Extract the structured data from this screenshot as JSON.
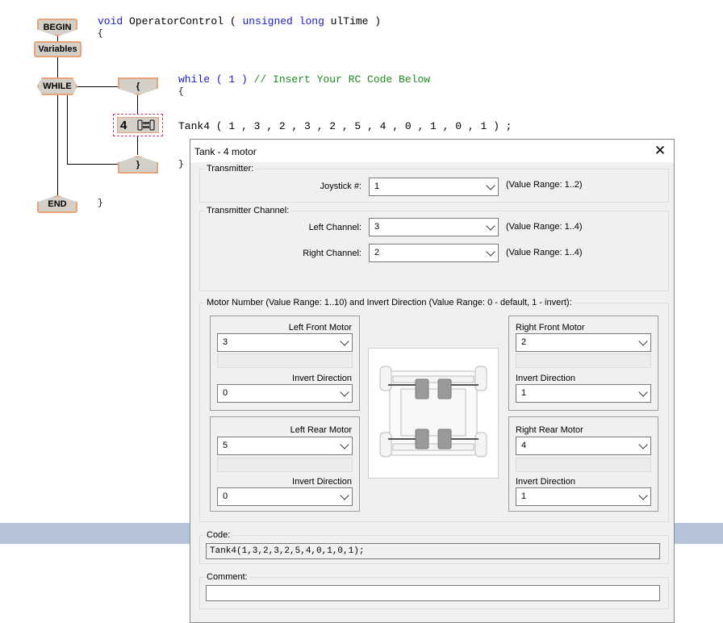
{
  "flowchart": {
    "begin": "BEGIN",
    "variables": "Variables",
    "while": "WHILE",
    "open_brace": "{",
    "close_brace": "}",
    "block_num": "4",
    "end": "END"
  },
  "code_view": {
    "line1_kw": "void",
    "line1_name": " OperatorControl ( ",
    "line1_kw2": "unsigned long",
    "line1_rest": " ulTime )",
    "brace_open": "{",
    "while_kw": "while",
    "while_rest": " ( 1 ) ",
    "while_comment": "// Insert Your RC Code Below",
    "brace_open2": "{",
    "tank_call": "Tank4 ( 1 , 3 , 2 , 3 , 2 , 5 , 4 , 0 , 1 , 0 , 1 ) ;",
    "brace_close_inner": "}",
    "brace_close": "}"
  },
  "dialog": {
    "title": "Tank - 4 motor",
    "close_symbol": "✕",
    "transmitter": {
      "legend": "Transmitter:",
      "joystick_label": "Joystick #:",
      "joystick_value": "1",
      "joystick_range": "(Value Range: 1..2)"
    },
    "channel": {
      "legend": "Transmitter Channel:",
      "left_label": "Left Channel:",
      "left_value": "3",
      "left_range": "(Value Range: 1..4)",
      "right_label": "Right Channel:",
      "right_value": "2",
      "right_range": "(Value Range: 1..4)"
    },
    "motor": {
      "legend": "Motor Number (Value Range: 1..10)  and  Invert Direction (Value Range: 0 - default, 1 - invert):",
      "left_front_label": "Left Front Motor",
      "left_front_value": "3",
      "left_front_invert_label": "Invert Direction",
      "left_front_invert_value": "0",
      "left_rear_label": "Left Rear Motor",
      "left_rear_value": "5",
      "left_rear_invert_label": "Invert Direction",
      "left_rear_invert_value": "0",
      "right_front_label": "Right Front Motor",
      "right_front_value": "2",
      "right_front_invert_label": "Invert Direction",
      "right_front_invert_value": "1",
      "right_rear_label": "Right Rear Motor",
      "right_rear_value": "4",
      "right_rear_invert_label": "Invert Direction",
      "right_rear_invert_value": "1"
    },
    "code": {
      "legend": "Code:",
      "value": "Tank4(1,3,2,3,2,5,4,0,1,0,1);"
    },
    "comment": {
      "legend": "Comment:",
      "value": ""
    }
  },
  "colors": {
    "node_fill": "#d4d0c8",
    "node_border": "#e8a37a",
    "keyword": "#1a1ad6",
    "comment": "#1f8c1f",
    "bottom_bar": "#b6c2d8"
  }
}
